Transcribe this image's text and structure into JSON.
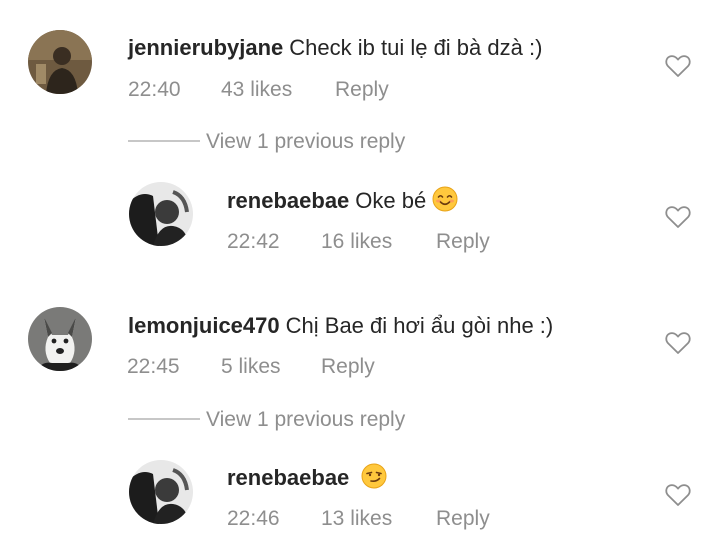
{
  "comments": [
    {
      "username": "jennierubyjane",
      "text": "Check ib tui lẹ đi bà dzà :)",
      "time": "22:40",
      "likes": "43 likes",
      "reply": "Reply",
      "view_previous": "View 1 previous reply"
    },
    {
      "username": "renebaebae",
      "text": "Oke bé",
      "emoji": "smiling-face-emoji",
      "time": "22:42",
      "likes": "16 likes",
      "reply": "Reply"
    },
    {
      "username": "lemonjuice470",
      "text": "Chị Bae đi hơi ẩu gòi nhe :)",
      "time": "22:45",
      "likes": "5 likes",
      "reply": "Reply",
      "view_previous": "View 1 previous reply"
    },
    {
      "username": "renebaebae",
      "text": "",
      "emoji": "smirking-face-emoji",
      "time": "22:46",
      "likes": "13 likes",
      "reply": "Reply"
    }
  ],
  "icons": {
    "like": "heart-outline-icon"
  },
  "colors": {
    "text": "#262626",
    "muted": "#8e8e8e",
    "divider": "#c7c7c7"
  }
}
